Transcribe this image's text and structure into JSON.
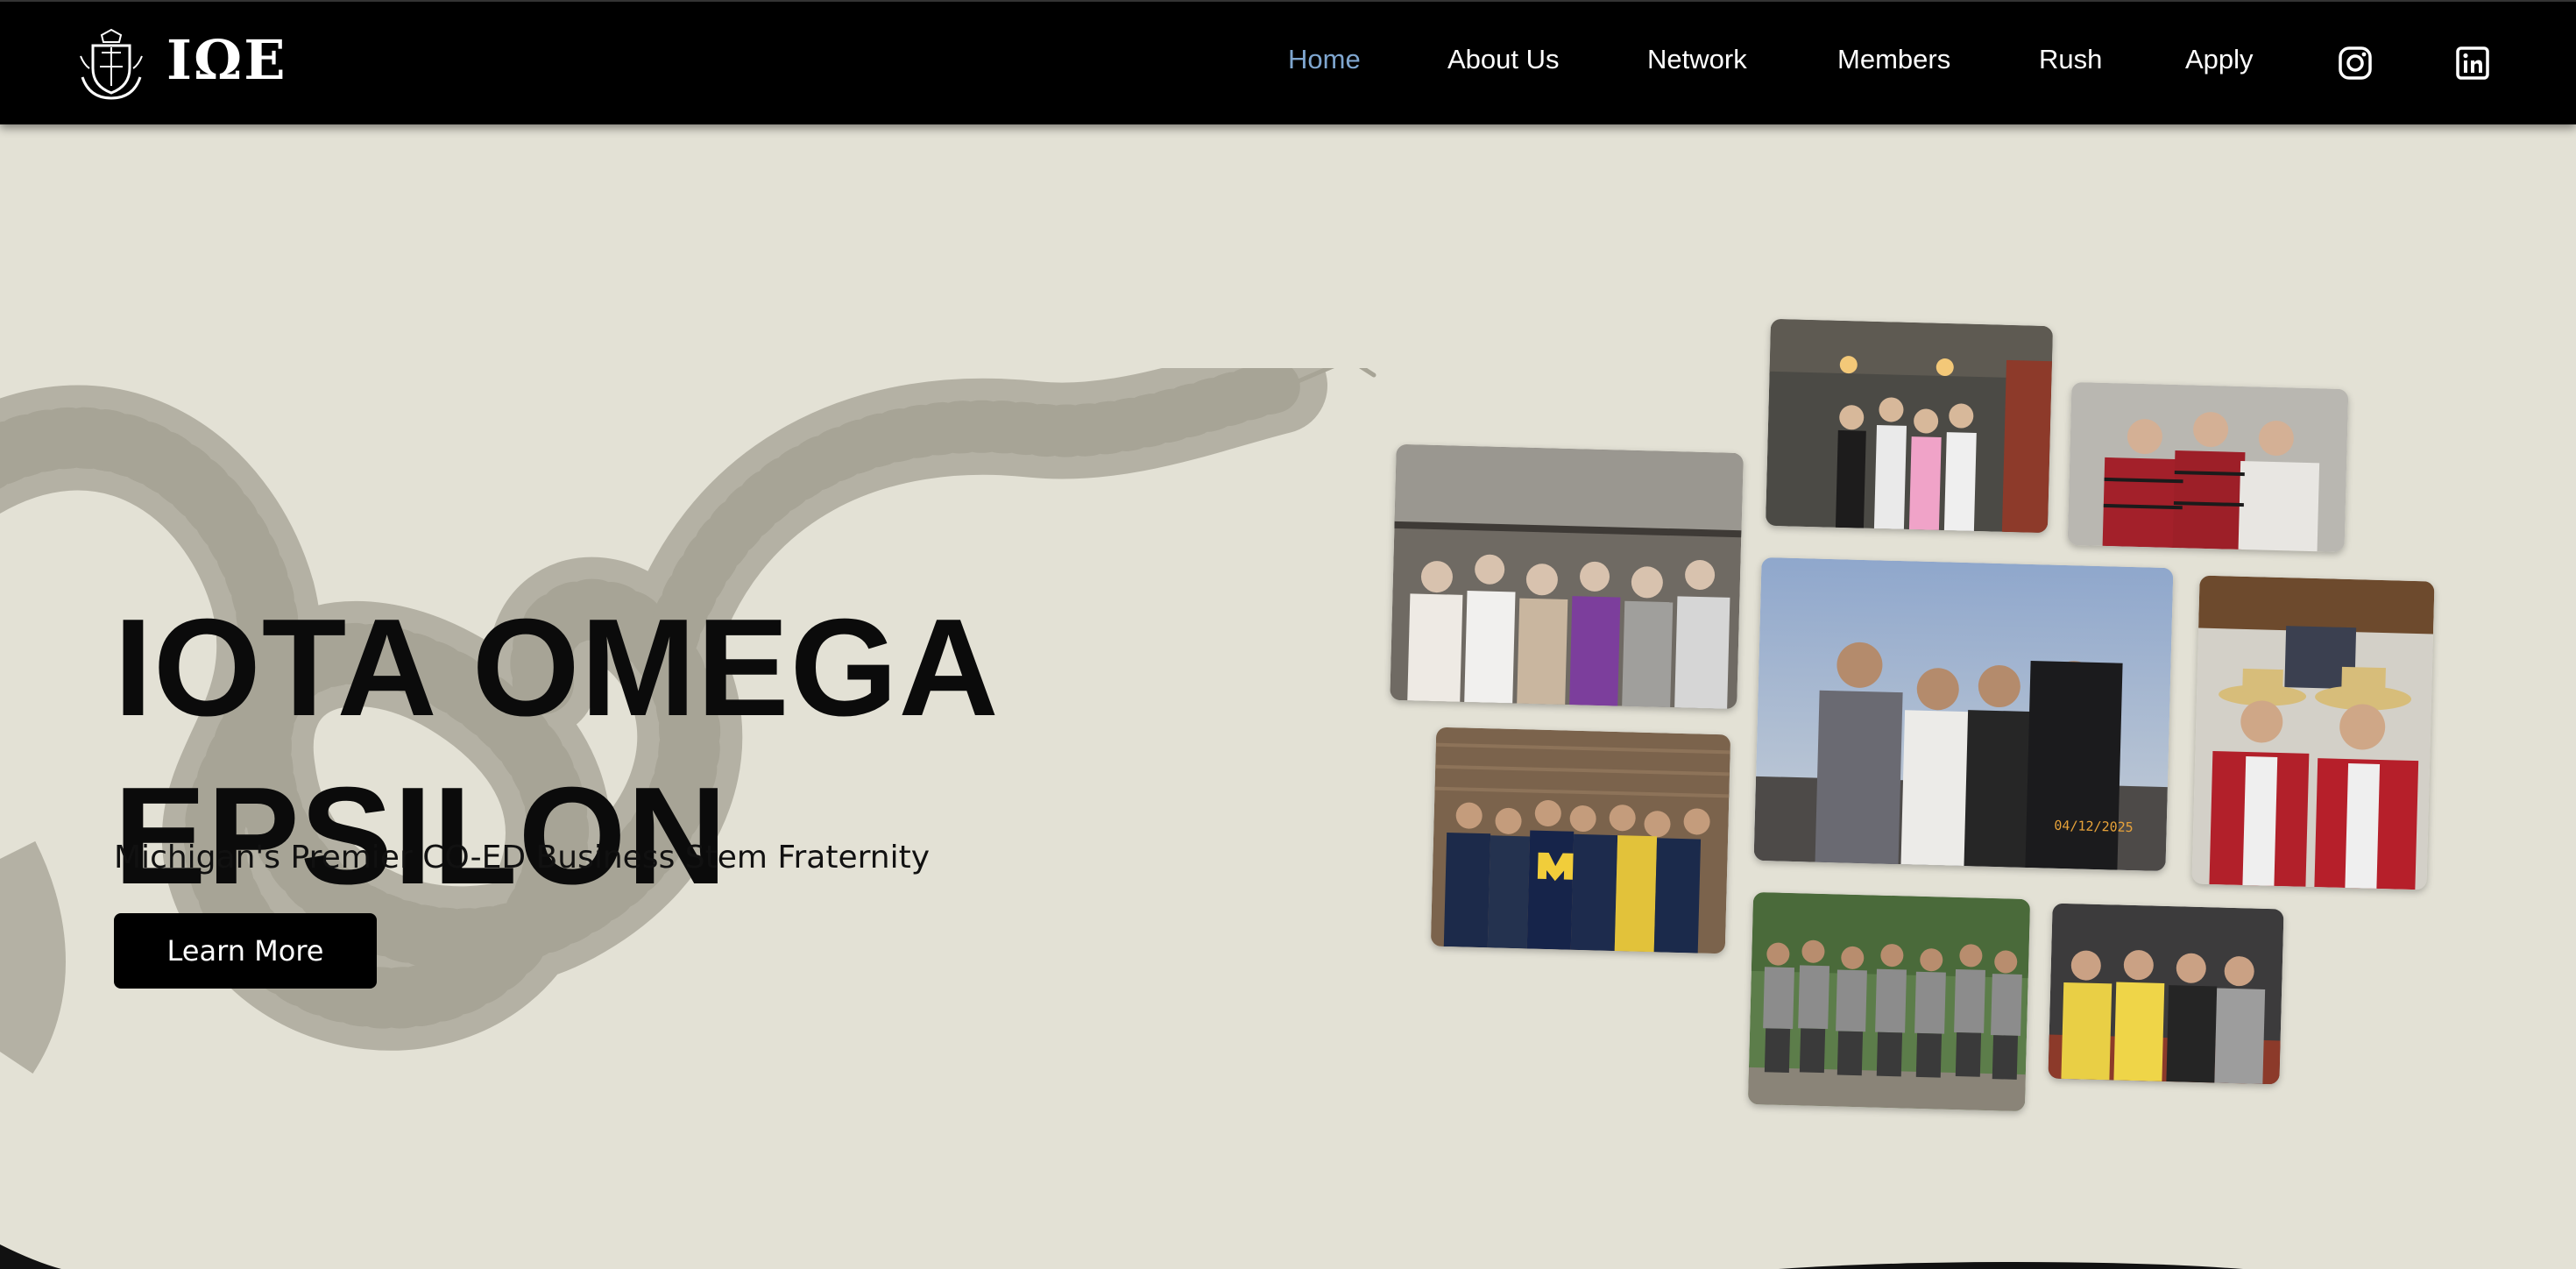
{
  "header": {
    "brand": "IΩE",
    "nav": [
      {
        "label": "Home",
        "active": true
      },
      {
        "label": "About Us",
        "active": false
      },
      {
        "label": "Network",
        "active": false
      },
      {
        "label": "Members",
        "active": false
      },
      {
        "label": "Rush",
        "active": false
      },
      {
        "label": "Apply",
        "active": false
      }
    ],
    "social": [
      {
        "icon": "instagram-icon"
      },
      {
        "icon": "linkedin-icon"
      }
    ]
  },
  "hero": {
    "title_line1": "IOTA OMEGA",
    "title_line2": "EPSILON",
    "subtitle": "Michigan's Premier CO-ED Business Stem Fraternity",
    "cta_label": "Learn More"
  },
  "gallery": {
    "photo_date": "04/12/2025"
  },
  "colors": {
    "background": "#e3e1d5",
    "navbar": "#000000",
    "nav_active": "#7fa6cf",
    "snake": "#b4b1a4",
    "cta": "#000000"
  }
}
